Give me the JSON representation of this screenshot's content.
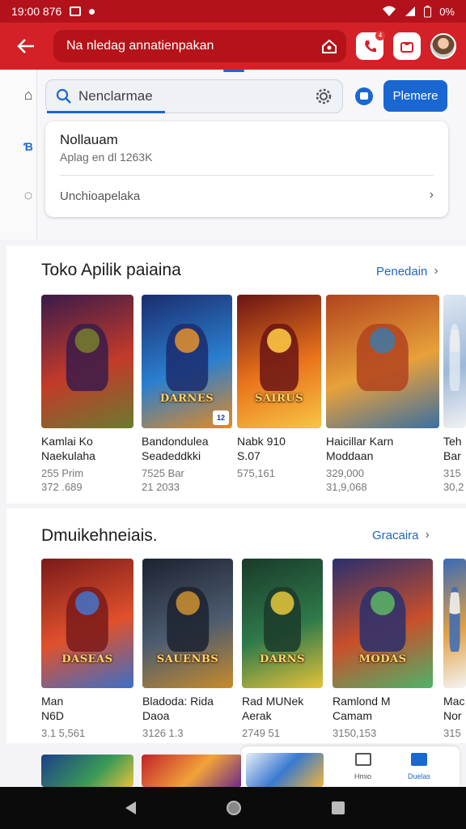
{
  "status_bar": {
    "time": "19:00 876",
    "battery": "0%"
  },
  "app_bar": {
    "url_text": "Na nledag annatienpakan",
    "notification_count": "4"
  },
  "search": {
    "query": "Nenclarmae",
    "primary_button": "Plemere"
  },
  "suggestion": {
    "title": "Nollauam",
    "subtitle": "Aplag en dl 1263K",
    "row": "Unchioapelaka"
  },
  "section1": {
    "title": "Toko Apilik paiaina",
    "link": "Penedain",
    "cards": [
      {
        "line1": "Kamlai Ko",
        "line2": "Naekulaha",
        "meta1": "255 Prim",
        "meta2": "372 .689",
        "logo": "",
        "badge": "",
        "colors": [
          "#3a1b4a",
          "#c33a2a",
          "#6a7b2f"
        ]
      },
      {
        "line1": "Bandondulea",
        "line2": "Seadeddkki",
        "meta1": "7525 Bar",
        "meta2": "21 2033",
        "logo": "DARNES",
        "badge": "12",
        "colors": [
          "#1b2c6e",
          "#2a7fcf",
          "#e38a22"
        ]
      },
      {
        "line1": "Nabk 910",
        "line2": "S.07",
        "meta1": "575,161",
        "meta2": "",
        "logo": "SAIRUS",
        "badge": "",
        "colors": [
          "#6b1414",
          "#e9731c",
          "#f7c644"
        ]
      },
      {
        "line1": "Haicillar Karn",
        "line2": "Moddaan",
        "meta1": "329,000",
        "meta2": "31,9,068",
        "logo": "",
        "badge": "",
        "colors": [
          "#b1431e",
          "#e8a13a",
          "#3a6fa3"
        ]
      },
      {
        "line1": "Teh",
        "line2": "Bar",
        "meta1": "315",
        "meta2": "30,2",
        "logo": "",
        "badge": "",
        "colors": [
          "#dfe8f3",
          "#9db8d8",
          "#f2f2f2"
        ]
      }
    ]
  },
  "section2": {
    "title": "Dmuikehneiais.",
    "link": "Gracaira",
    "cards": [
      {
        "line1": "Man",
        "line2": "N6D",
        "meta1": "3.1 5,561",
        "meta2": "",
        "logo": "DASEAS",
        "badge": "",
        "colors": [
          "#7a1a1a",
          "#e0512c",
          "#3b6fc7"
        ]
      },
      {
        "line1": "Bladoda: Rida",
        "line2": "Daoa",
        "meta1": "3126 1.3",
        "meta2": "",
        "logo": "SAUENBS",
        "badge": "",
        "colors": [
          "#1c2230",
          "#4d5c70",
          "#c78b2a"
        ]
      },
      {
        "line1": "Rad MUNek",
        "line2": "Aerak",
        "meta1": "2749 51",
        "meta2": "",
        "logo": "DARNS",
        "badge": "",
        "colors": [
          "#1a3a2a",
          "#2f7a4a",
          "#e5c23a"
        ]
      },
      {
        "line1": "Ramlond M",
        "line2": "Camam",
        "meta1": "3150,153",
        "meta2": "",
        "logo": "MODAS",
        "badge": "",
        "colors": [
          "#2a2f6e",
          "#c94f2a",
          "#4db36a"
        ]
      },
      {
        "line1": "Mac",
        "line2": "Nor",
        "meta1": "315",
        "meta2": "",
        "logo": "",
        "badge": "",
        "colors": [
          "#3a6ab8",
          "#e0a144",
          "#f4f4f4"
        ]
      }
    ]
  },
  "bottom_tabs": [
    {
      "label": "Hmio"
    },
    {
      "label": "Duelas"
    }
  ]
}
